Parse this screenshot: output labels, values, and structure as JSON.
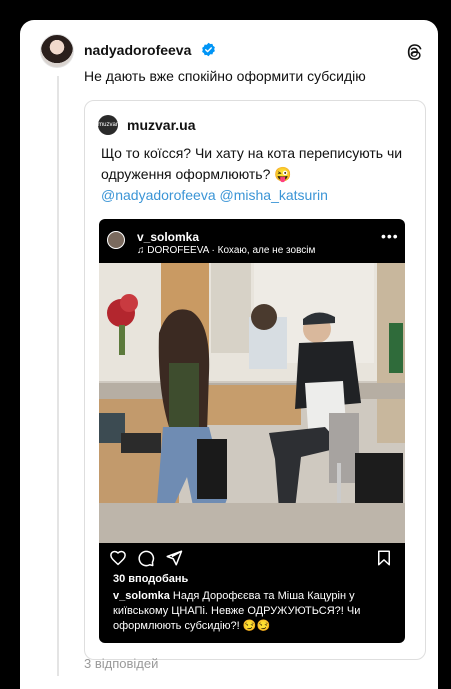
{
  "post": {
    "username": "nadyadorofeeva",
    "text": "Не дають вже спокійно оформити субсидію",
    "replies": "3 відповідей"
  },
  "quoted": {
    "avatar_text": "muzvar",
    "username": "muzvar.ua",
    "text": "Що то коїсся? Чи хату на кота переписують чи одруження оформлюють? 😜",
    "mentions": "@nadyadorofeeva @misha_katsurin"
  },
  "instagram": {
    "username": "v_solomka",
    "music": "♫ DOROFEEVA · Кохаю, але не зовсім",
    "more": "•••",
    "likes": "30 вподобань",
    "caption_user": "v_solomka",
    "caption_text": " Надя Дорофєєва та Міша Кацурін у київському ЦНАПі. Невже ОДРУЖУЮТЬСЯ?! Чи оформлюють субсидію?! 😏😏"
  },
  "colors": {
    "mention": "#3b95d6",
    "verified": "#0095f6",
    "background": "#000000"
  },
  "icons": [
    "verified-badge-icon",
    "threads-logo-icon",
    "heart-icon",
    "comment-icon",
    "share-icon",
    "bookmark-icon",
    "mute-icon"
  ]
}
